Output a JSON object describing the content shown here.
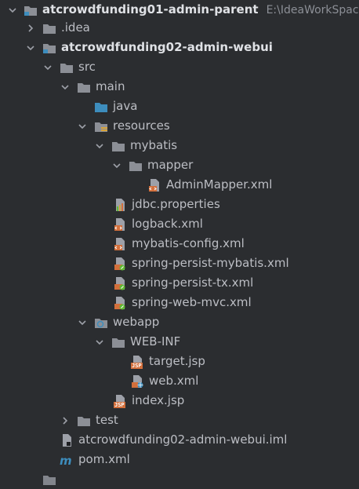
{
  "tree": {
    "root": {
      "label": "atcrowdfunding01-admin-parent",
      "path": "E:\\IdeaWorkSpace\\a"
    },
    "idea": {
      "label": ".idea"
    },
    "module": {
      "label": "atcrowdfunding02-admin-webui"
    },
    "src": {
      "label": "src"
    },
    "main": {
      "label": "main"
    },
    "java": {
      "label": "java"
    },
    "resources": {
      "label": "resources"
    },
    "mybatis": {
      "label": "mybatis"
    },
    "mapper": {
      "label": "mapper"
    },
    "adminmapper": {
      "label": "AdminMapper.xml"
    },
    "jdbc": {
      "label": "jdbc.properties"
    },
    "logback": {
      "label": "logback.xml"
    },
    "mybatis_config": {
      "label": "mybatis-config.xml"
    },
    "spring_persist_mybatis": {
      "label": "spring-persist-mybatis.xml"
    },
    "spring_persist_tx": {
      "label": "spring-persist-tx.xml"
    },
    "spring_web_mvc": {
      "label": "spring-web-mvc.xml"
    },
    "webapp": {
      "label": "webapp"
    },
    "webinf": {
      "label": "WEB-INF"
    },
    "target_jsp": {
      "label": "target.jsp"
    },
    "web_xml": {
      "label": "web.xml"
    },
    "index_jsp": {
      "label": "index.jsp"
    },
    "test": {
      "label": "test"
    },
    "iml": {
      "label": "atcrowdfunding02-admin-webui.iml"
    },
    "pom": {
      "label": "pom.xml"
    },
    "jsp_badge": "JSP",
    "xml_badge": "<>"
  },
  "colors": {
    "background": "#2b2d30",
    "text": "#bcbec4",
    "folder": "#8c8f96",
    "source_folder": "#3d8dbd",
    "xml_badge": "#d36f3b",
    "spring_leaf": "#5fb832"
  }
}
